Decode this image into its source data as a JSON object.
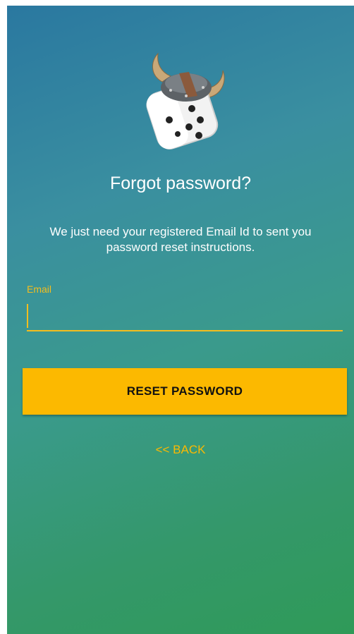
{
  "app": {
    "logo_icon": "viking-dice-icon",
    "accent_color": "#fcb900",
    "gradient_colors": [
      "#2a78a0",
      "#2f9a58"
    ]
  },
  "header": {
    "title": "Forgot password?",
    "subtitle": "We just need your registered Email Id to sent you password reset instructions."
  },
  "form": {
    "email_label": "Email",
    "email_value": "",
    "email_placeholder": ""
  },
  "actions": {
    "reset_label": "RESET PASSWORD",
    "back_label": "<< BACK"
  }
}
